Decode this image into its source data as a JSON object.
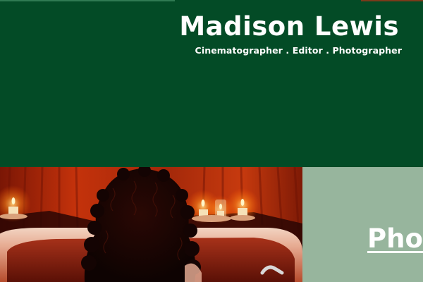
{
  "header": {
    "title": "Madison Lewis",
    "tagline": "Cinematographer . Editor . Photographer",
    "background_color": "#034b26"
  },
  "featured_photo": {
    "subject": "person with curly hair in a bathtub surrounded by candles",
    "tone_color": "#c2300a"
  },
  "side_panel": {
    "link_label": "Photography",
    "background_color": "#97b59d"
  }
}
